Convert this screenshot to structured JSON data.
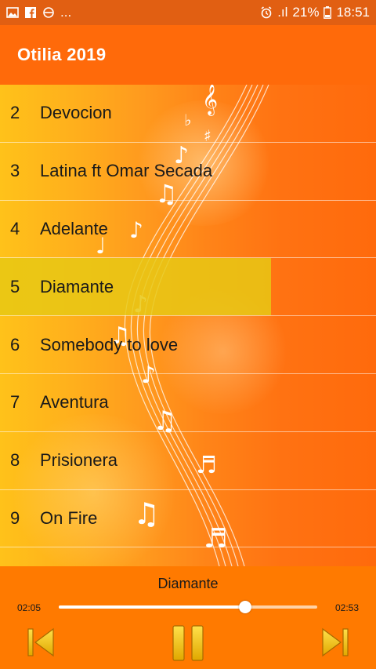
{
  "status_bar": {
    "left_icons": [
      "gallery-icon",
      "facebook-icon",
      "sync-icon"
    ],
    "more_indicator": "...",
    "signal": ".ıl",
    "battery_percent": "21%",
    "time": "18:51"
  },
  "app_bar": {
    "title": "Otilia 2019"
  },
  "tracks": [
    {
      "number": "2",
      "title": "Devocion",
      "selected": false
    },
    {
      "number": "3",
      "title": "Latina ft Omar Secada",
      "selected": false
    },
    {
      "number": "4",
      "title": "Adelante",
      "selected": false
    },
    {
      "number": "5",
      "title": "Diamante",
      "selected": true
    },
    {
      "number": "6",
      "title": "Somebody to love",
      "selected": false
    },
    {
      "number": "7",
      "title": "Aventura",
      "selected": false
    },
    {
      "number": "8",
      "title": "Prisionera",
      "selected": false
    },
    {
      "number": "9",
      "title": "On Fire",
      "selected": false
    }
  ],
  "player": {
    "now_playing": "Diamante",
    "current_time": "02:05",
    "total_time": "02:53",
    "progress_fraction": 0.72
  },
  "colors": {
    "accent": "#ff6a0a",
    "highlight": "#e8c814",
    "controls": "#f5c400"
  }
}
